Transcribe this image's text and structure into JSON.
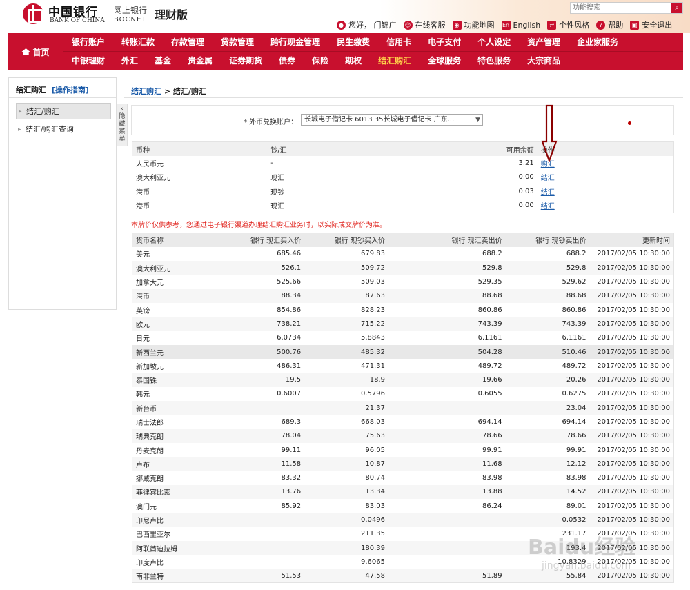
{
  "header": {
    "logo_cn": "中国银行",
    "logo_en": "BANK OF CHINA",
    "ebank": "网上银行",
    "bocnet": "BOCNET",
    "edition": "理财版",
    "search_placeholder": "功能搜索",
    "greeting": "您好， 门锦广",
    "links": [
      {
        "label": "在线客服",
        "icon": "customer-service-icon"
      },
      {
        "label": "功能地图",
        "icon": "map-pin-icon"
      },
      {
        "label": "English",
        "icon": "english-icon"
      },
      {
        "label": "个性风格",
        "icon": "style-icon"
      },
      {
        "label": "帮助",
        "icon": "help-icon"
      },
      {
        "label": "安全退出",
        "icon": "lock-icon"
      }
    ]
  },
  "nav": {
    "home": "首页",
    "row1": [
      "银行账户",
      "转账汇款",
      "存款管理",
      "贷款管理",
      "跨行现金管理",
      "民生缴费",
      "信用卡",
      "电子支付",
      "个人设定",
      "资产管理",
      "企业家服务"
    ],
    "row2": [
      "中银理财",
      "外汇",
      "基金",
      "贵金属",
      "证券期货",
      "债券",
      "保险",
      "期权",
      "结汇购汇",
      "全球服务",
      "特色服务",
      "大宗商品"
    ],
    "active": "结汇购汇"
  },
  "sidebar": {
    "title": "结汇购汇",
    "guide": "[操作指南]",
    "items": [
      "结汇/购汇",
      "结汇/购汇查询"
    ],
    "toggle": "隐藏菜单"
  },
  "breadcrumb": {
    "parent": "结汇购汇",
    "sep": ">",
    "current": "结汇/购汇"
  },
  "account": {
    "label": "* 外币兑换账户：",
    "selected": "长城电子借记卡 6013        35长城电子借记卡 广东..."
  },
  "balance": {
    "headers": [
      "币种",
      "钞/汇",
      "可用余额",
      "操作"
    ],
    "rows": [
      {
        "currency": "人民币元",
        "type": "-",
        "amount": "3.21",
        "action": "购汇"
      },
      {
        "currency": "澳大利亚元",
        "type": "现汇",
        "amount": "0.00",
        "action": "结汇"
      },
      {
        "currency": "港币",
        "type": "现钞",
        "amount": "0.03",
        "action": "结汇"
      },
      {
        "currency": "港币",
        "type": "现汇",
        "amount": "0.00",
        "action": "结汇"
      }
    ]
  },
  "notice": "本牌价仅供参考，您通过电子银行渠道办理结汇购汇业务时，以实际成交牌价为准。",
  "rates": {
    "headers": [
      "货币名称",
      "银行 现汇买入价",
      "银行 现钞买入价",
      "银行 现汇卖出价",
      "银行 现钞卖出价",
      "更新时间"
    ],
    "rows": [
      [
        "美元",
        "685.46",
        "679.83",
        "688.2",
        "688.2",
        "2017/02/05 10:30:00"
      ],
      [
        "澳大利亚元",
        "526.1",
        "509.72",
        "529.8",
        "529.8",
        "2017/02/05 10:30:00"
      ],
      [
        "加拿大元",
        "525.66",
        "509.03",
        "529.35",
        "529.62",
        "2017/02/05 10:30:00"
      ],
      [
        "港币",
        "88.34",
        "87.63",
        "88.68",
        "88.68",
        "2017/02/05 10:30:00"
      ],
      [
        "英镑",
        "854.86",
        "828.23",
        "860.86",
        "860.86",
        "2017/02/05 10:30:00"
      ],
      [
        "欧元",
        "738.21",
        "715.22",
        "743.39",
        "743.39",
        "2017/02/05 10:30:00"
      ],
      [
        "日元",
        "6.0734",
        "5.8843",
        "6.1161",
        "6.1161",
        "2017/02/05 10:30:00"
      ],
      [
        "新西兰元",
        "500.76",
        "485.32",
        "504.28",
        "510.46",
        "2017/02/05 10:30:00"
      ],
      [
        "新加坡元",
        "486.31",
        "471.31",
        "489.72",
        "489.72",
        "2017/02/05 10:30:00"
      ],
      [
        "泰国铢",
        "19.5",
        "18.9",
        "19.66",
        "20.26",
        "2017/02/05 10:30:00"
      ],
      [
        "韩元",
        "0.6007",
        "0.5796",
        "0.6055",
        "0.6275",
        "2017/02/05 10:30:00"
      ],
      [
        "新台币",
        "",
        "21.37",
        "",
        "23.04",
        "2017/02/05 10:30:00"
      ],
      [
        "瑞士法郎",
        "689.3",
        "668.03",
        "694.14",
        "694.14",
        "2017/02/05 10:30:00"
      ],
      [
        "瑞典克朗",
        "78.04",
        "75.63",
        "78.66",
        "78.66",
        "2017/02/05 10:30:00"
      ],
      [
        "丹麦克朗",
        "99.11",
        "96.05",
        "99.91",
        "99.91",
        "2017/02/05 10:30:00"
      ],
      [
        "卢布",
        "11.58",
        "10.87",
        "11.68",
        "12.12",
        "2017/02/05 10:30:00"
      ],
      [
        "挪威克朗",
        "83.32",
        "80.74",
        "83.98",
        "83.98",
        "2017/02/05 10:30:00"
      ],
      [
        "菲律宾比索",
        "13.76",
        "13.34",
        "13.88",
        "14.52",
        "2017/02/05 10:30:00"
      ],
      [
        "澳门元",
        "85.92",
        "83.03",
        "86.24",
        "89.01",
        "2017/02/05 10:30:00"
      ],
      [
        "印尼卢比",
        "",
        "0.0496",
        "",
        "0.0532",
        "2017/02/05 10:30:00"
      ],
      [
        "巴西里亚尔",
        "",
        "211.35",
        "",
        "231.17",
        "2017/02/05 10:30:00"
      ],
      [
        "阿联酋迪拉姆",
        "",
        "180.39",
        "",
        "193.4",
        "2017/02/05 10:30:00"
      ],
      [
        "印度卢比",
        "",
        "9.6065",
        "",
        "10.8329",
        "2017/02/05 10:30:00"
      ],
      [
        "南非兰特",
        "51.53",
        "47.58",
        "51.89",
        "55.84",
        "2017/02/05 10:30:00"
      ]
    ]
  },
  "watermark": {
    "main": "Baidu经验",
    "sub": "jingyan.baidu.com"
  },
  "colors": {
    "brand_red": "#c8102e",
    "active_nav": "#ffd24a",
    "link": "#1a5aa8",
    "notice": "#e0201a"
  }
}
